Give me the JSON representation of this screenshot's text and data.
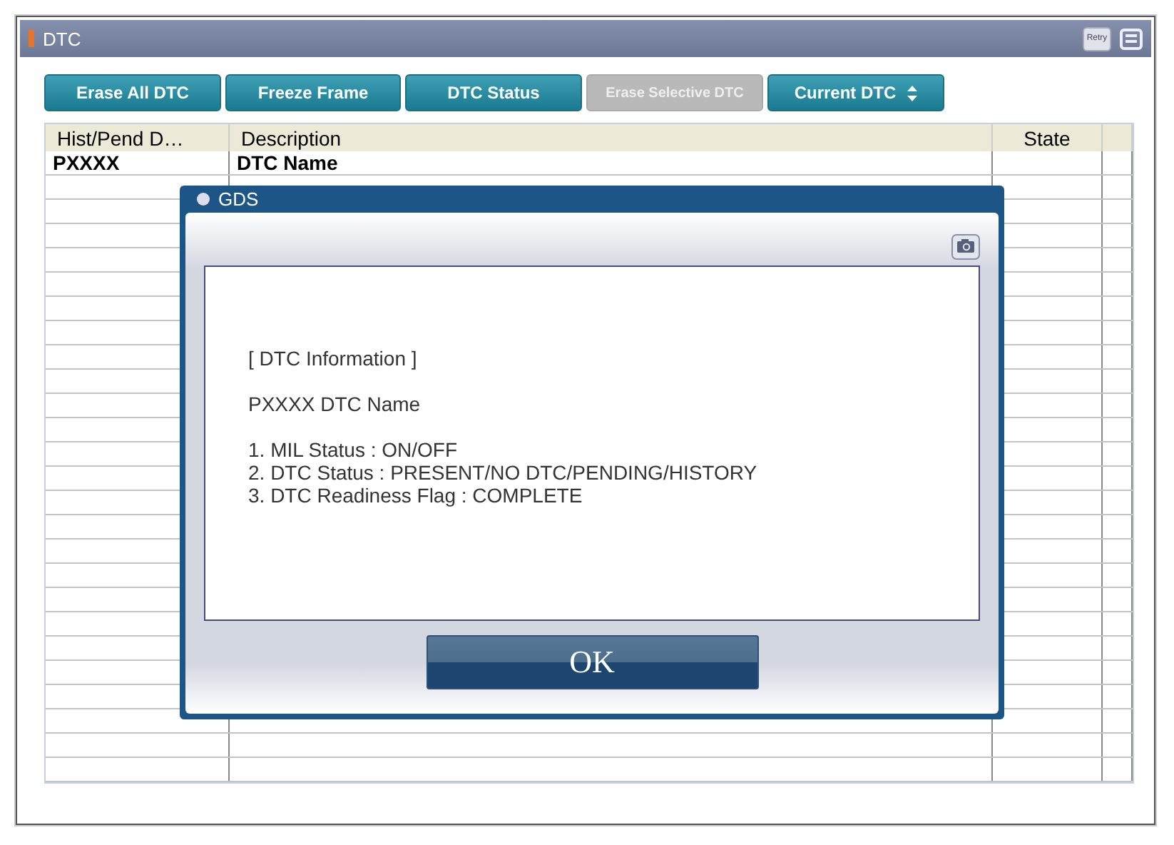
{
  "window": {
    "title": "DTC",
    "retry_label": "Retry"
  },
  "toolbar": [
    {
      "label": "Erase All DTC",
      "disabled": false,
      "kind": "button"
    },
    {
      "label": "Freeze Frame",
      "disabled": false,
      "kind": "button"
    },
    {
      "label": "DTC Status",
      "disabled": false,
      "kind": "button"
    },
    {
      "label": "Erase Selective DTC",
      "disabled": true,
      "kind": "button"
    },
    {
      "label": "Current DTC",
      "disabled": false,
      "kind": "dropdown"
    }
  ],
  "table": {
    "columns": [
      "Hist/Pend D…",
      "Description",
      "State"
    ],
    "rows": [
      [
        "PXXXX",
        "DTC Name",
        ""
      ]
    ]
  },
  "dialog": {
    "title": "GDS",
    "heading": "[ DTC Information ]",
    "dtc_line": "PXXXX  DTC Name",
    "items": [
      "1. MIL Status : ON/OFF",
      "2. DTC Status : PRESENT/NO DTC/PENDING/HISTORY",
      "3. DTC Readiness Flag : COMPLETE"
    ],
    "button": "OK"
  }
}
